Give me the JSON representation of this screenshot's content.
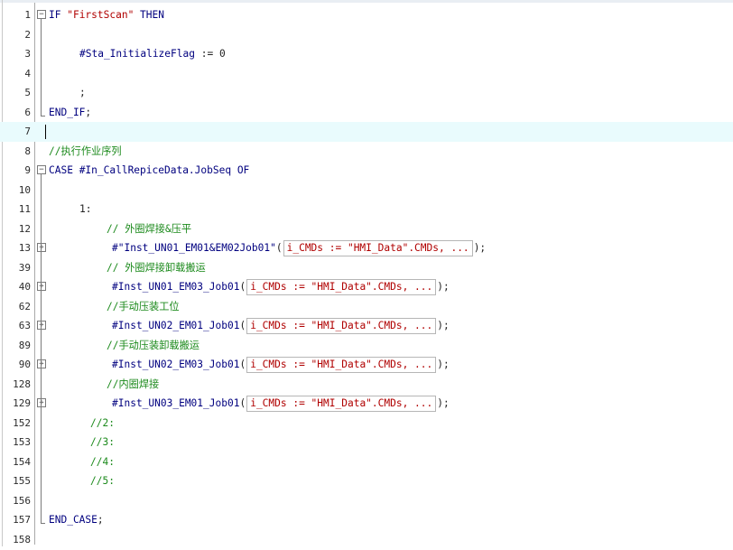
{
  "editor": {
    "lines": [
      {
        "n": "1",
        "parts": [
          {
            "t": "IF ",
            "c": "kw"
          },
          {
            "t": "\"FirstScan\"",
            "c": "str"
          },
          {
            "t": " THEN",
            "c": "kw"
          }
        ]
      },
      {
        "n": "2",
        "parts": []
      },
      {
        "n": "3",
        "parts": [
          {
            "t": "#Sta_InitializeFlag",
            "c": "var"
          },
          {
            "t": " := ",
            "c": "op"
          },
          {
            "t": "0",
            "c": "num"
          }
        ]
      },
      {
        "n": "4",
        "parts": []
      },
      {
        "n": "5",
        "parts": [
          {
            "t": ";",
            "c": "op"
          }
        ]
      },
      {
        "n": "6",
        "parts": [
          {
            "t": "END_IF",
            "c": "kw"
          },
          {
            "t": ";",
            "c": "op"
          }
        ]
      },
      {
        "n": "7",
        "parts": []
      },
      {
        "n": "8",
        "parts": [
          {
            "t": "//执行作业序列",
            "c": "cmt"
          }
        ]
      },
      {
        "n": "9",
        "parts": [
          {
            "t": "CASE ",
            "c": "kw"
          },
          {
            "t": "#In_CallRepiceData.JobSeq",
            "c": "var"
          },
          {
            "t": " OF",
            "c": "kw"
          }
        ]
      },
      {
        "n": "10",
        "parts": []
      },
      {
        "n": "11",
        "parts": [
          {
            "t": "1:",
            "c": "op"
          }
        ]
      },
      {
        "n": "12",
        "parts": [
          {
            "t": "// 外圈焊接&压平",
            "c": "cmt"
          }
        ]
      },
      {
        "n": "13",
        "parts": [
          {
            "t": "#\"Inst_UN01_EM01&EM02Job01\"",
            "c": "var"
          },
          {
            "t": "(",
            "c": "op"
          },
          {
            "t": "i_CMDs := \"HMI_Data\".CMDs, ...",
            "c": "box"
          },
          {
            "t": ");",
            "c": "op"
          }
        ]
      },
      {
        "n": "39",
        "parts": [
          {
            "t": "// 外圈焊接卸载搬运",
            "c": "cmt"
          }
        ]
      },
      {
        "n": "40",
        "parts": [
          {
            "t": "#Inst_UN01_EM03_Job01",
            "c": "var"
          },
          {
            "t": "(",
            "c": "op"
          },
          {
            "t": "i_CMDs := \"HMI_Data\".CMDs, ...",
            "c": "box"
          },
          {
            "t": ");",
            "c": "op"
          }
        ]
      },
      {
        "n": "62",
        "parts": [
          {
            "t": "//手动压装工位",
            "c": "cmt"
          }
        ]
      },
      {
        "n": "63",
        "parts": [
          {
            "t": "#Inst_UN02_EM01_Job01",
            "c": "var"
          },
          {
            "t": "(",
            "c": "op"
          },
          {
            "t": "i_CMDs := \"HMI_Data\".CMDs, ...",
            "c": "box"
          },
          {
            "t": ");",
            "c": "op"
          }
        ]
      },
      {
        "n": "89",
        "parts": [
          {
            "t": "//手动压装卸载搬运",
            "c": "cmt"
          }
        ]
      },
      {
        "n": "90",
        "parts": [
          {
            "t": "#Inst_UN02_EM03_Job01",
            "c": "var"
          },
          {
            "t": "(",
            "c": "op"
          },
          {
            "t": "i_CMDs := \"HMI_Data\".CMDs, ...",
            "c": "box"
          },
          {
            "t": ");",
            "c": "op"
          }
        ]
      },
      {
        "n": "128",
        "parts": [
          {
            "t": "//内圈焊接",
            "c": "cmt"
          }
        ]
      },
      {
        "n": "129",
        "parts": [
          {
            "t": "#Inst_UN03_EM01_Job01",
            "c": "var"
          },
          {
            "t": "(",
            "c": "op"
          },
          {
            "t": "i_CMDs := \"HMI_Data\".CMDs, ...",
            "c": "box"
          },
          {
            "t": ");",
            "c": "op"
          }
        ]
      },
      {
        "n": "152",
        "parts": [
          {
            "t": "//2:",
            "c": "cmt"
          }
        ]
      },
      {
        "n": "153",
        "parts": [
          {
            "t": "//3:",
            "c": "cmt"
          }
        ]
      },
      {
        "n": "154",
        "parts": [
          {
            "t": "//4:",
            "c": "cmt"
          }
        ]
      },
      {
        "n": "155",
        "parts": [
          {
            "t": "//5:",
            "c": "cmt"
          }
        ]
      },
      {
        "n": "156",
        "parts": []
      },
      {
        "n": "157",
        "parts": [
          {
            "t": "END_CASE",
            "c": "kw"
          },
          {
            "t": ";",
            "c": "op"
          }
        ]
      },
      {
        "n": "158",
        "parts": []
      }
    ],
    "fold_markers": {
      "1": "−",
      "9": "−",
      "13": "+",
      "40": "+",
      "63": "+",
      "90": "+",
      "129": "+"
    }
  }
}
